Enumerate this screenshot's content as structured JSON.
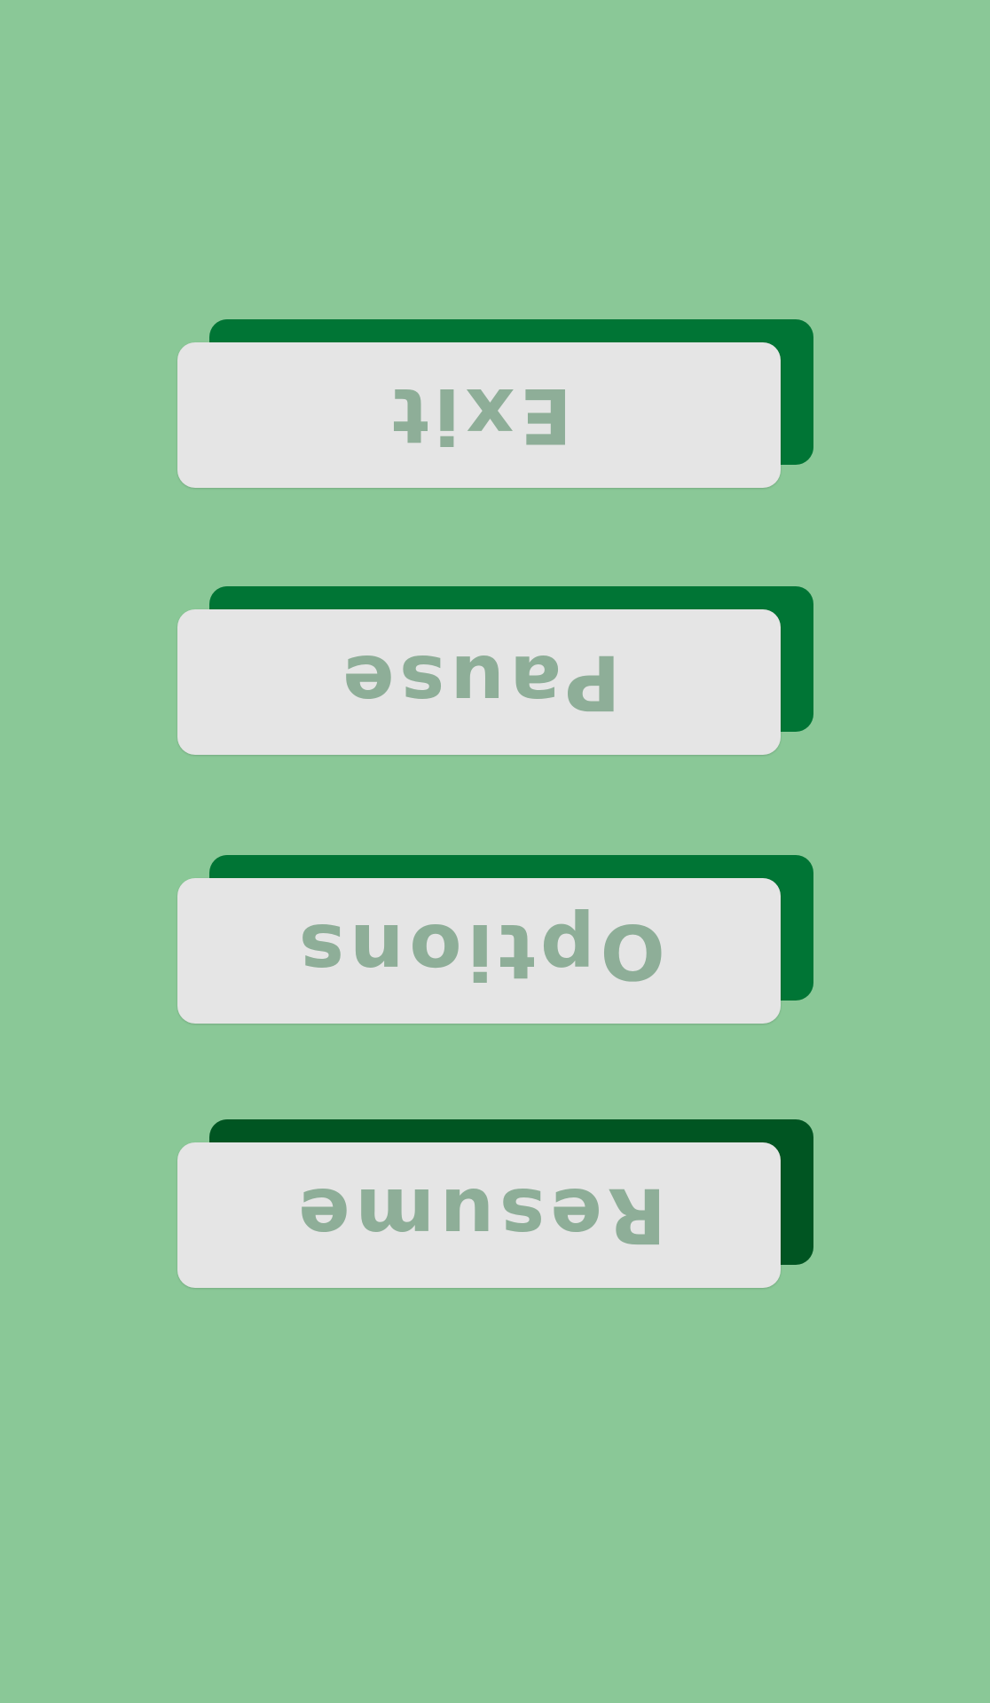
{
  "colors": {
    "background": "#8ac897",
    "button_face": "#e5e5e5",
    "label_text": "#8eae98",
    "shadow_default": "#007535",
    "shadow_selected": "#005522"
  },
  "menu": {
    "items": [
      {
        "label": "Exit",
        "shadow": "#007535"
      },
      {
        "label": "Pause",
        "shadow": "#007535"
      },
      {
        "label": "Options",
        "shadow": "#007535"
      },
      {
        "label": "Resume",
        "shadow": "#005522"
      }
    ]
  }
}
